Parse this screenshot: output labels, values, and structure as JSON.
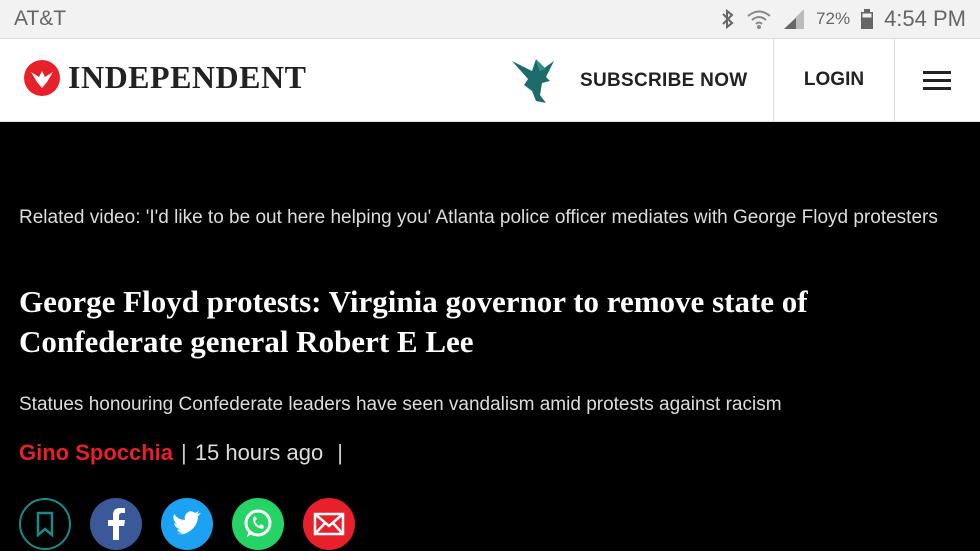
{
  "status_bar": {
    "carrier": "AT&T",
    "battery": "72%",
    "time": "4:54 PM"
  },
  "header": {
    "logo_text": "INDEPENDENT",
    "subscribe_label": "SUBSCRIBE NOW",
    "login_label": "LOGIN"
  },
  "article": {
    "related_video": "Related video: 'I'd like to be out here helping you' Atlanta police officer mediates with George Floyd protesters",
    "headline": "George Floyd protests: Virginia governor to remove state of Confederate general Robert E Lee",
    "standfirst": "Statues honouring Confederate leaders have seen vandalism amid protests against racism",
    "author": "Gino Spocchia",
    "separator": "|",
    "time_ago": "15 hours ago",
    "trailing_separator": "|"
  },
  "colors": {
    "brand_red": "#e8202a",
    "facebook": "#3b5998",
    "twitter": "#1da1f2",
    "whatsapp": "#25d366",
    "email": "#e8202a",
    "bookmark": "#1a8a8a"
  },
  "share_icons": [
    "bookmark-icon",
    "facebook-icon",
    "twitter-icon",
    "whatsapp-icon",
    "email-icon"
  ]
}
